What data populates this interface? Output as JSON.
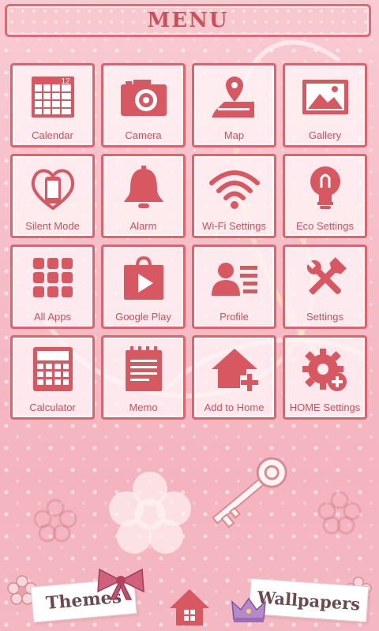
{
  "header": {
    "title": "MENU"
  },
  "calendar_day": "12",
  "tiles": [
    {
      "label": "Calendar",
      "icon": "calendar-icon"
    },
    {
      "label": "Camera",
      "icon": "camera-icon"
    },
    {
      "label": "Map",
      "icon": "map-icon"
    },
    {
      "label": "Gallery",
      "icon": "gallery-icon"
    },
    {
      "label": "Silent Mode",
      "icon": "silent-mode-icon"
    },
    {
      "label": "Alarm",
      "icon": "bell-icon"
    },
    {
      "label": "Wi-Fi Settings",
      "icon": "wifi-icon"
    },
    {
      "label": "Eco Settings",
      "icon": "bulb-icon"
    },
    {
      "label": "All Apps",
      "icon": "grid-icon"
    },
    {
      "label": "Google Play",
      "icon": "play-store-icon"
    },
    {
      "label": "Profile",
      "icon": "profile-icon"
    },
    {
      "label": "Settings",
      "icon": "tools-icon"
    },
    {
      "label": "Calculator",
      "icon": "calculator-icon"
    },
    {
      "label": "Memo",
      "icon": "memo-icon"
    },
    {
      "label": "Add to Home",
      "icon": "add-home-icon"
    },
    {
      "label": "HOME Settings",
      "icon": "gear-plus-icon"
    }
  ],
  "footer": {
    "themes_label": "Themes",
    "wallpapers_label": "Wallpapers",
    "home_icon": "home-icon"
  },
  "colors": {
    "accent": "#e0636c",
    "text": "#c8525c",
    "background": "#f5bcc6"
  }
}
